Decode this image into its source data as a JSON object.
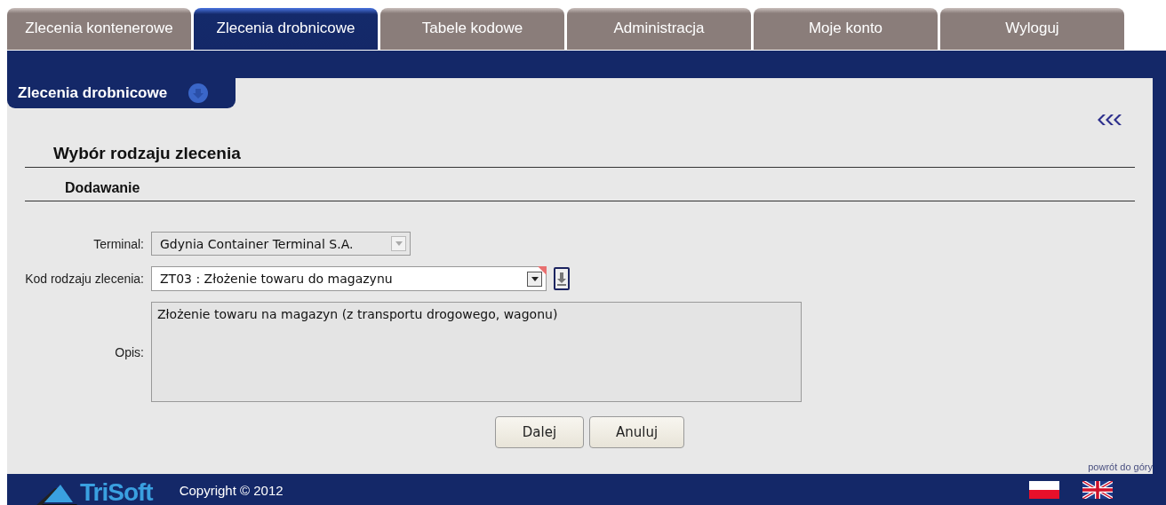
{
  "tabs": [
    {
      "label": "Zlecenia kontenerowe",
      "selected": false
    },
    {
      "label": "Zlecenia drobnicowe",
      "selected": true
    },
    {
      "label": "Tabele kodowe",
      "selected": false
    },
    {
      "label": "Administracja",
      "selected": false
    },
    {
      "label": "Moje konto",
      "selected": false
    },
    {
      "label": "Wyloguj",
      "selected": false
    }
  ],
  "panel": {
    "title": "Zlecenia drobnicowe"
  },
  "section_title": "Wybór rodzaju zlecenia",
  "subsection_title": "Dodawanie",
  "form": {
    "fields": [
      {
        "kind": "select",
        "label": "Terminal:",
        "value": "Gdynia Container Terminal S.A.",
        "disabled": true
      },
      {
        "kind": "select",
        "label": "Kod rodzaju zlecenia:",
        "value": "ZT03 : Złożenie towaru do magazynu",
        "disabled": false,
        "required": true
      },
      {
        "kind": "textarea",
        "label": "Opis:",
        "value": "Złożenie towaru na magazyn (z transportu drogowego, wagonu)",
        "disabled": true
      }
    ]
  },
  "buttons": [
    "Dalej",
    "Anuluj"
  ],
  "back_to_top": "powrót do góry",
  "footer": {
    "logo": "TriSoft",
    "copyright": "Copyright © 2012"
  }
}
